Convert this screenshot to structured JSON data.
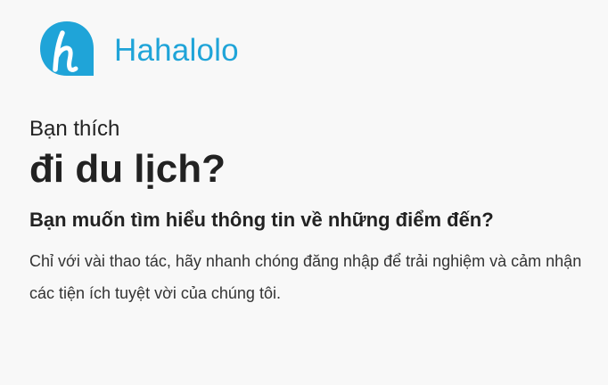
{
  "brand": {
    "logo_icon": "hahalolo-h-logo-icon",
    "name": "Hahalolo",
    "color": "#1fa4d8"
  },
  "hero": {
    "kicker": "Bạn thích",
    "headline": "đi du lịch?",
    "subheadline": "Bạn muốn tìm hiểu thông tin về những điểm đến?",
    "description": "Chỉ với vài thao tác, hãy nhanh chóng đăng nhập để trải nghiệm và cảm nhận các tiện ích tuyệt vời của chúng tôi."
  }
}
